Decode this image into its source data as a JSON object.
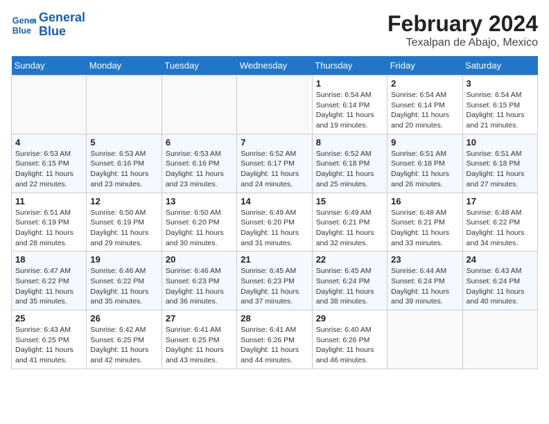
{
  "logo": {
    "line1": "General",
    "line2": "Blue"
  },
  "title": "February 2024",
  "location": "Texalpan de Abajo, Mexico",
  "days_of_week": [
    "Sunday",
    "Monday",
    "Tuesday",
    "Wednesday",
    "Thursday",
    "Friday",
    "Saturday"
  ],
  "weeks": [
    [
      {
        "day": "",
        "sunrise": "",
        "sunset": "",
        "daylight": "",
        "empty": true
      },
      {
        "day": "",
        "sunrise": "",
        "sunset": "",
        "daylight": "",
        "empty": true
      },
      {
        "day": "",
        "sunrise": "",
        "sunset": "",
        "daylight": "",
        "empty": true
      },
      {
        "day": "",
        "sunrise": "",
        "sunset": "",
        "daylight": "",
        "empty": true
      },
      {
        "day": "1",
        "sunrise": "6:54 AM",
        "sunset": "6:14 PM",
        "daylight": "11 hours and 19 minutes.",
        "empty": false
      },
      {
        "day": "2",
        "sunrise": "6:54 AM",
        "sunset": "6:14 PM",
        "daylight": "11 hours and 20 minutes.",
        "empty": false
      },
      {
        "day": "3",
        "sunrise": "6:54 AM",
        "sunset": "6:15 PM",
        "daylight": "11 hours and 21 minutes.",
        "empty": false
      }
    ],
    [
      {
        "day": "4",
        "sunrise": "6:53 AM",
        "sunset": "6:15 PM",
        "daylight": "11 hours and 22 minutes.",
        "empty": false
      },
      {
        "day": "5",
        "sunrise": "6:53 AM",
        "sunset": "6:16 PM",
        "daylight": "11 hours and 23 minutes.",
        "empty": false
      },
      {
        "day": "6",
        "sunrise": "6:53 AM",
        "sunset": "6:16 PM",
        "daylight": "11 hours and 23 minutes.",
        "empty": false
      },
      {
        "day": "7",
        "sunrise": "6:52 AM",
        "sunset": "6:17 PM",
        "daylight": "11 hours and 24 minutes.",
        "empty": false
      },
      {
        "day": "8",
        "sunrise": "6:52 AM",
        "sunset": "6:18 PM",
        "daylight": "11 hours and 25 minutes.",
        "empty": false
      },
      {
        "day": "9",
        "sunrise": "6:51 AM",
        "sunset": "6:18 PM",
        "daylight": "11 hours and 26 minutes.",
        "empty": false
      },
      {
        "day": "10",
        "sunrise": "6:51 AM",
        "sunset": "6:18 PM",
        "daylight": "11 hours and 27 minutes.",
        "empty": false
      }
    ],
    [
      {
        "day": "11",
        "sunrise": "6:51 AM",
        "sunset": "6:19 PM",
        "daylight": "11 hours and 28 minutes.",
        "empty": false
      },
      {
        "day": "12",
        "sunrise": "6:50 AM",
        "sunset": "6:19 PM",
        "daylight": "11 hours and 29 minutes.",
        "empty": false
      },
      {
        "day": "13",
        "sunrise": "6:50 AM",
        "sunset": "6:20 PM",
        "daylight": "11 hours and 30 minutes.",
        "empty": false
      },
      {
        "day": "14",
        "sunrise": "6:49 AM",
        "sunset": "6:20 PM",
        "daylight": "11 hours and 31 minutes.",
        "empty": false
      },
      {
        "day": "15",
        "sunrise": "6:49 AM",
        "sunset": "6:21 PM",
        "daylight": "11 hours and 32 minutes.",
        "empty": false
      },
      {
        "day": "16",
        "sunrise": "6:48 AM",
        "sunset": "6:21 PM",
        "daylight": "11 hours and 33 minutes.",
        "empty": false
      },
      {
        "day": "17",
        "sunrise": "6:48 AM",
        "sunset": "6:22 PM",
        "daylight": "11 hours and 34 minutes.",
        "empty": false
      }
    ],
    [
      {
        "day": "18",
        "sunrise": "6:47 AM",
        "sunset": "6:22 PM",
        "daylight": "11 hours and 35 minutes.",
        "empty": false
      },
      {
        "day": "19",
        "sunrise": "6:46 AM",
        "sunset": "6:22 PM",
        "daylight": "11 hours and 35 minutes.",
        "empty": false
      },
      {
        "day": "20",
        "sunrise": "6:46 AM",
        "sunset": "6:23 PM",
        "daylight": "11 hours and 36 minutes.",
        "empty": false
      },
      {
        "day": "21",
        "sunrise": "6:45 AM",
        "sunset": "6:23 PM",
        "daylight": "11 hours and 37 minutes.",
        "empty": false
      },
      {
        "day": "22",
        "sunrise": "6:45 AM",
        "sunset": "6:24 PM",
        "daylight": "11 hours and 38 minutes.",
        "empty": false
      },
      {
        "day": "23",
        "sunrise": "6:44 AM",
        "sunset": "6:24 PM",
        "daylight": "11 hours and 39 minutes.",
        "empty": false
      },
      {
        "day": "24",
        "sunrise": "6:43 AM",
        "sunset": "6:24 PM",
        "daylight": "11 hours and 40 minutes.",
        "empty": false
      }
    ],
    [
      {
        "day": "25",
        "sunrise": "6:43 AM",
        "sunset": "6:25 PM",
        "daylight": "11 hours and 41 minutes.",
        "empty": false
      },
      {
        "day": "26",
        "sunrise": "6:42 AM",
        "sunset": "6:25 PM",
        "daylight": "11 hours and 42 minutes.",
        "empty": false
      },
      {
        "day": "27",
        "sunrise": "6:41 AM",
        "sunset": "6:25 PM",
        "daylight": "11 hours and 43 minutes.",
        "empty": false
      },
      {
        "day": "28",
        "sunrise": "6:41 AM",
        "sunset": "6:26 PM",
        "daylight": "11 hours and 44 minutes.",
        "empty": false
      },
      {
        "day": "29",
        "sunrise": "6:40 AM",
        "sunset": "6:26 PM",
        "daylight": "11 hours and 46 minutes.",
        "empty": false
      },
      {
        "day": "",
        "sunrise": "",
        "sunset": "",
        "daylight": "",
        "empty": true
      },
      {
        "day": "",
        "sunrise": "",
        "sunset": "",
        "daylight": "",
        "empty": true
      }
    ]
  ]
}
